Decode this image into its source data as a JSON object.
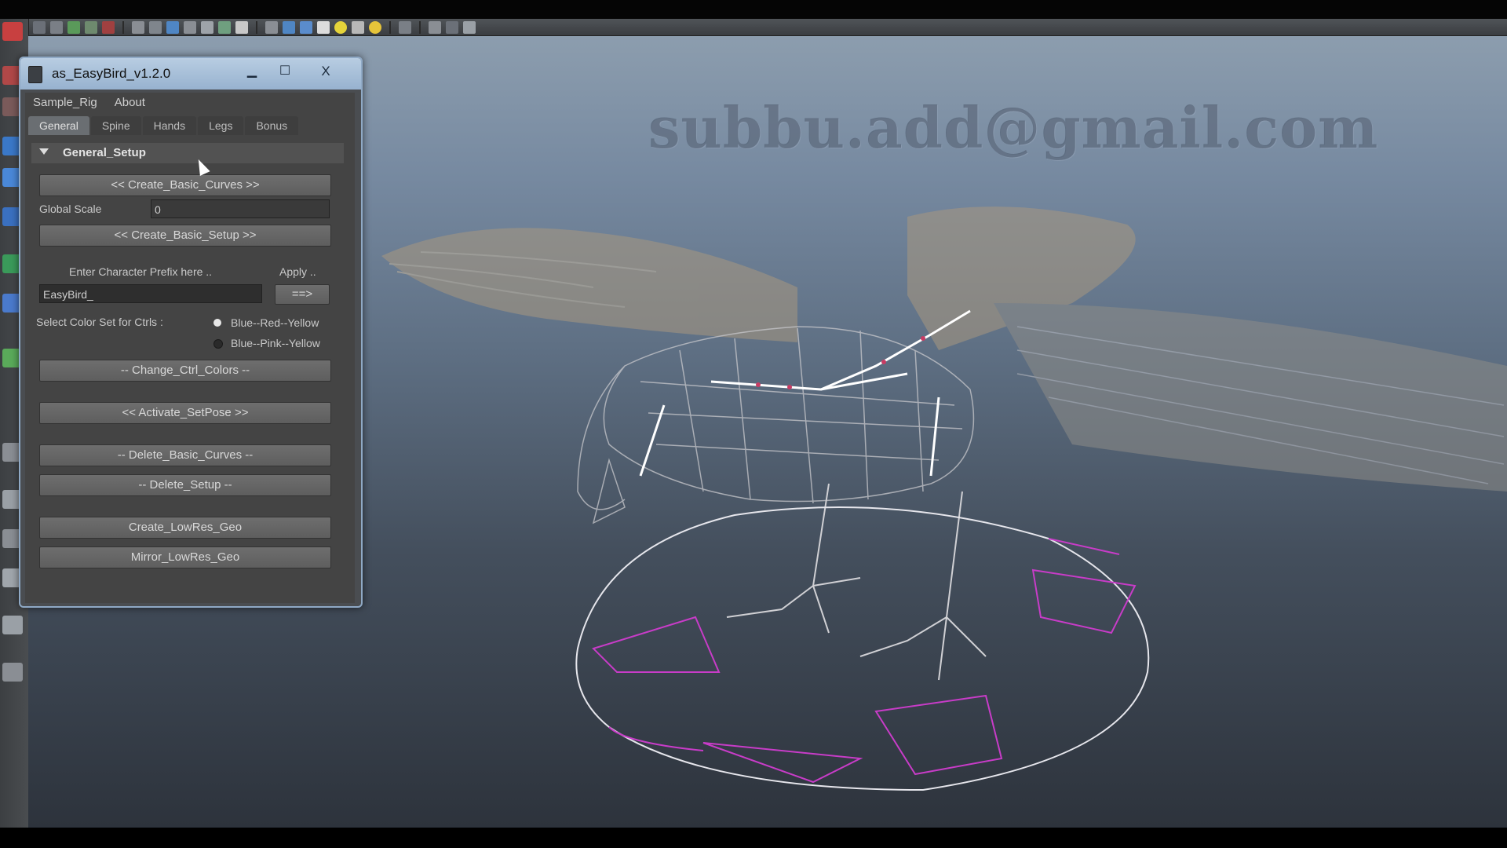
{
  "window": {
    "title": "as_EasyBird_v1.2.0",
    "min_glyph": "▁",
    "max_glyph": "☐",
    "close_glyph": "X"
  },
  "menu": [
    "Sample_Rig",
    "About"
  ],
  "tabs": [
    {
      "label": "General",
      "active": true
    },
    {
      "label": "Spine",
      "active": false
    },
    {
      "label": "Hands",
      "active": false
    },
    {
      "label": "Legs",
      "active": false
    },
    {
      "label": "Bonus",
      "active": false
    }
  ],
  "general_setup": {
    "section_label": "General_Setup",
    "create_basic_curves": "<< Create_Basic_Curves >>",
    "global_scale_label": "Global Scale",
    "global_scale_value": "0",
    "create_basic_setup": "<< Create_Basic_Setup >>",
    "prefix_label": "Enter Character Prefix here ..",
    "apply_label": "Apply ..",
    "prefix_value": "EasyBird_",
    "apply_button": "==>",
    "color_set_label": "Select Color Set for Ctrls :",
    "color_option_1": "Blue--Red--Yellow",
    "color_option_2": "Blue--Pink--Yellow",
    "change_ctrl_colors": "-- Change_Ctrl_Colors --",
    "activate_setpose": "<< Activate_SetPose >>",
    "delete_basic_curves": "-- Delete_Basic_Curves --",
    "delete_setup": "-- Delete_Setup --",
    "create_lowres_geo": "Create_LowRes_Geo",
    "mirror_lowres_geo": "Mirror_LowRes_Geo"
  },
  "watermark": "subbu.add@gmail.com",
  "colors": {
    "panel_border": "#8fa9c5",
    "ctrl_magenta": "#c83cc8",
    "wire_grey": "#b0b0b4"
  }
}
